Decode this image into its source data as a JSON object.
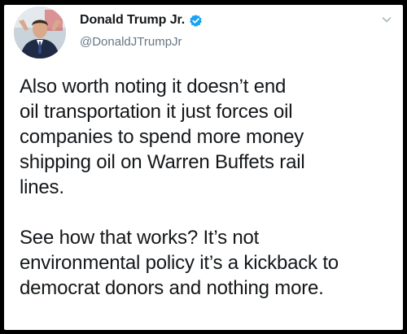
{
  "tweet": {
    "author": {
      "display_name": "Donald Trump Jr.",
      "handle": "@DonaldJTrumpJr",
      "verified": true,
      "avatar_icon": "avatar-photo"
    },
    "menu_icon": "chevron-down-icon",
    "paragraphs": [
      "Also worth noting it doesn’t end\noil transportation it just forces oil\ncompanies to spend more money\nshipping oil on Warren Buffets rail\nlines.",
      "See how that works? It’s not\nenvironmental policy it’s a kickback to\ndemocrat donors and nothing more."
    ]
  },
  "colors": {
    "background": "#000000",
    "card": "#ffffff",
    "text": "#14171a",
    "handle": "#657786",
    "verified_badge": "#1da1f2",
    "chevron": "#aab8c2"
  }
}
